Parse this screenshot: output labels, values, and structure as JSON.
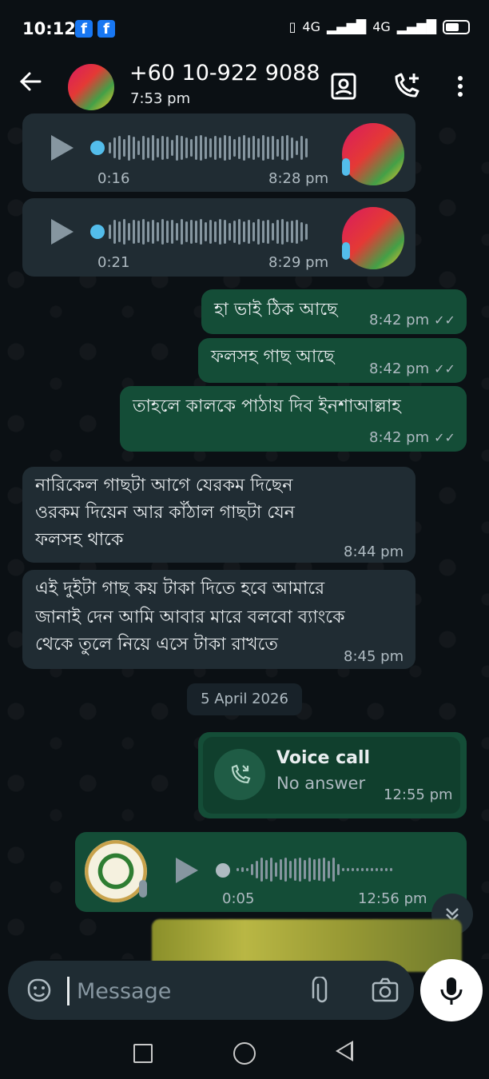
{
  "status_bar": {
    "time": "10:12",
    "network_1": "4G",
    "network_2": "4G"
  },
  "header": {
    "contact_name": "+60 10-922 9088",
    "last_seen": "7:53 pm"
  },
  "messages": {
    "voice_1": {
      "duration": "0:16",
      "time": "8:28 pm"
    },
    "voice_2": {
      "duration": "0:21",
      "time": "8:29 pm"
    },
    "out_1": {
      "text": "হা ভাই ঠিক আছে",
      "time": "8:42 pm"
    },
    "out_2": {
      "text": "ফলসহ গাছ আছে",
      "time": "8:42 pm"
    },
    "out_3": {
      "text": "তাহলে কালকে পাঠায় দিব ইনশাআল্লাহ",
      "time": "8:42 pm"
    },
    "in_1": {
      "lines": [
        "নারিকেল গাছটা আগে যেরকম দিছেন",
        "ওরকম দিয়েন আর কাঁঠাল গাছটা যেন",
        "ফলসহ থাকে"
      ],
      "time": "8:44 pm"
    },
    "in_2": {
      "lines": [
        "এই দুইটা গাছ কয় টাকা দিতে হবে আমারে",
        "জানাই দেন আমি আবার মারে বলবো ব্যাংকে",
        "থেকে তুলে নিয়ে এসে টাকা রাখতে"
      ],
      "time": "8:45 pm"
    },
    "date_divider": "5 April 2026",
    "call": {
      "title": "Voice call",
      "status": "No answer",
      "time": "12:55 pm"
    },
    "voice_out": {
      "duration": "0:05",
      "time": "12:56 pm"
    }
  },
  "composer": {
    "placeholder": "Message"
  },
  "colors": {
    "incoming": "#202c33",
    "outgoing": "#144d37",
    "accent_blue": "#53bdeb",
    "background": "#0b1014"
  }
}
